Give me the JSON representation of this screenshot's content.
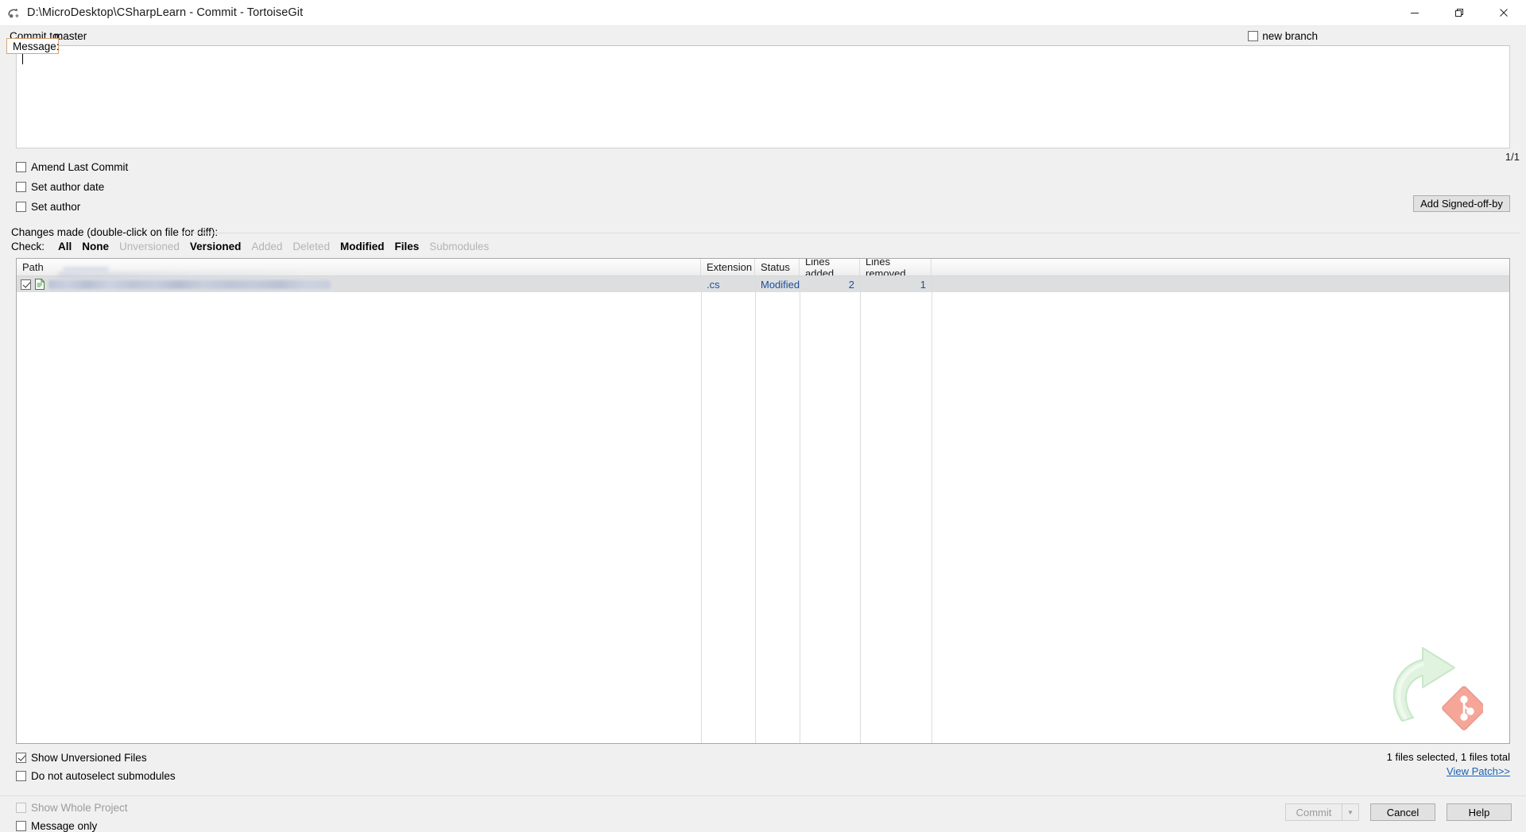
{
  "window": {
    "title": "D:\\MicroDesktop\\CSharpLearn - Commit - TortoiseGit",
    "icon": "tortoisegit-icon",
    "controls": {
      "minimize": "minimize-icon",
      "restore": "restore-icon",
      "close": "close-icon"
    }
  },
  "commit_to": {
    "label": "Commit to:",
    "branch": "master",
    "new_branch_label": "new branch",
    "new_branch_checked": false
  },
  "message": {
    "label": "Message:",
    "value": "",
    "placeholder": "",
    "counter": "1/1"
  },
  "options": [
    {
      "label": "Amend Last Commit",
      "checked": false,
      "disabled": false,
      "name": "amend-last-commit"
    },
    {
      "label": "Set author date",
      "checked": false,
      "disabled": false,
      "name": "set-author-date"
    },
    {
      "label": "Set author",
      "checked": false,
      "disabled": false,
      "name": "set-author"
    }
  ],
  "signed_off_button": "Add Signed-off-by",
  "changes": {
    "heading": "Changes made (double-click on file for diff):",
    "check_label": "Check:",
    "filters": [
      {
        "label": "All",
        "enabled": true
      },
      {
        "label": "None",
        "enabled": true
      },
      {
        "label": "Unversioned",
        "enabled": false
      },
      {
        "label": "Versioned",
        "enabled": true
      },
      {
        "label": "Added",
        "enabled": false
      },
      {
        "label": "Deleted",
        "enabled": false
      },
      {
        "label": "Modified",
        "enabled": true
      },
      {
        "label": "Files",
        "enabled": true
      },
      {
        "label": "Submodules",
        "enabled": false
      }
    ],
    "columns": [
      "Path",
      "Extension",
      "Status",
      "Lines added",
      "Lines removed"
    ],
    "rows": [
      {
        "checked": true,
        "icon": "text-file-icon",
        "path": "",
        "path_redacted": true,
        "extension": ".cs",
        "status": "Modified",
        "lines_added": "2",
        "lines_removed": "1"
      }
    ]
  },
  "footer": {
    "show_unversioned": {
      "label": "Show Unversioned Files",
      "checked": true,
      "disabled": false
    },
    "no_autoselect_submodules": {
      "label": "Do not autoselect submodules",
      "checked": false,
      "disabled": false
    },
    "show_whole_project": {
      "label": "Show Whole Project",
      "checked": false,
      "disabled": true
    },
    "message_only": {
      "label": "Message only",
      "checked": false,
      "disabled": false
    },
    "files_status": "1 files selected, 1 files total",
    "view_patch": "View Patch>>"
  },
  "buttons": {
    "commit": "Commit",
    "commit_disabled": true,
    "commit_dropdown": "chevron-down-icon",
    "cancel": "Cancel",
    "help": "Help"
  },
  "colors": {
    "accent_link": "#1a5fb4",
    "message_focus_border": "#d8a373",
    "row_selected": "#dddedf",
    "cell_text": "#1a4f9c"
  }
}
